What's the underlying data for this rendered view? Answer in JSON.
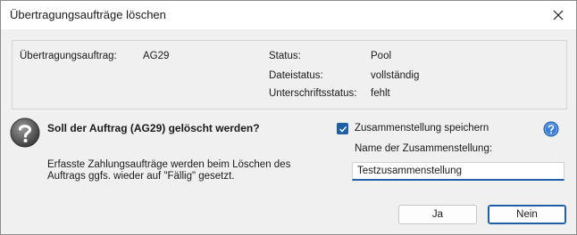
{
  "window": {
    "title": "Übertragungsaufträge löschen"
  },
  "info": {
    "order_label": "Übertragungsauftrag:",
    "order_value": "AG29",
    "status_label": "Status:",
    "status_value": "Pool",
    "file_status_label": "Dateistatus:",
    "file_status_value": "vollständig",
    "signature_status_label": "Unterschriftsstatus:",
    "signature_status_value": "fehlt"
  },
  "question": "Soll der Auftrag (AG29) gelöscht werden?",
  "note": "Erfasste Zahlungsaufträge werden beim Löschen des Auftrags ggfs. wieder auf \"Fällig\" gesetzt.",
  "save_compilation": {
    "label": "Zusammenstellung speichern",
    "checked": true
  },
  "compilation_name": {
    "label": "Name der Zusammenstellung:",
    "value": "Testzusammenstellung"
  },
  "buttons": {
    "yes": "Ja",
    "no": "Nein"
  },
  "colors": {
    "accent": "#1f5fa8"
  }
}
